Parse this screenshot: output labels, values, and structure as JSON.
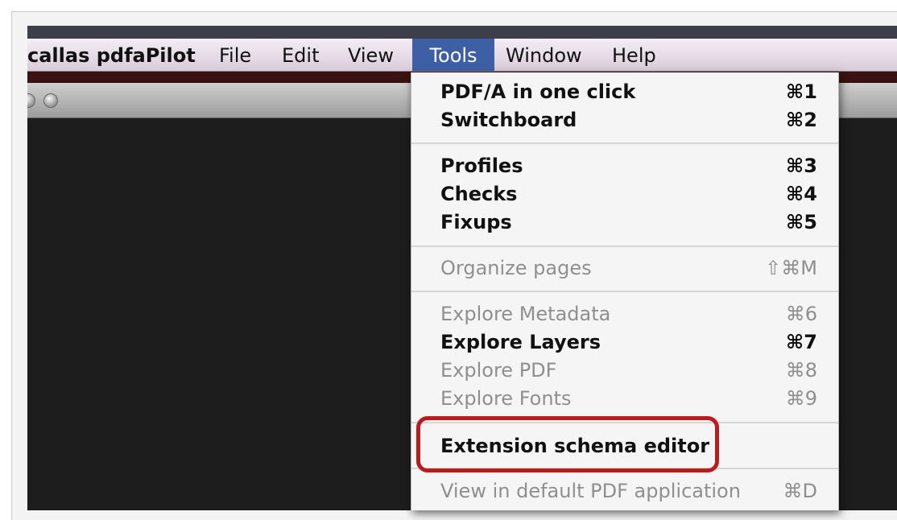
{
  "menubar": {
    "app_name": "callas pdfaPilot",
    "items": [
      "File",
      "Edit",
      "View",
      "Tools",
      "Window",
      "Help"
    ]
  },
  "tools_menu": {
    "groups": [
      [
        {
          "label": "PDF/A in one click",
          "shortcut": "⌘1",
          "enabled": true
        },
        {
          "label": "Switchboard",
          "shortcut": "⌘2",
          "enabled": true
        }
      ],
      [
        {
          "label": "Profiles",
          "shortcut": "⌘3",
          "enabled": true
        },
        {
          "label": "Checks",
          "shortcut": "⌘4",
          "enabled": true
        },
        {
          "label": "Fixups",
          "shortcut": "⌘5",
          "enabled": true
        }
      ],
      [
        {
          "label": "Organize pages",
          "shortcut": "⇧⌘M",
          "enabled": false
        }
      ],
      [
        {
          "label": "Explore Metadata",
          "shortcut": "⌘6",
          "enabled": false
        },
        {
          "label": "Explore Layers",
          "shortcut": "⌘7",
          "enabled": true
        },
        {
          "label": "Explore PDF",
          "shortcut": "⌘8",
          "enabled": false
        },
        {
          "label": "Explore Fonts",
          "shortcut": "⌘9",
          "enabled": false
        }
      ],
      [
        {
          "label": "Extension schema editor",
          "shortcut": "",
          "enabled": true
        }
      ],
      [
        {
          "label": "View in default PDF application",
          "shortcut": "⌘D",
          "enabled": false
        }
      ]
    ]
  },
  "colors": {
    "menu_highlight": "#3d5fa5",
    "annotation_red": "#b81c1c"
  }
}
